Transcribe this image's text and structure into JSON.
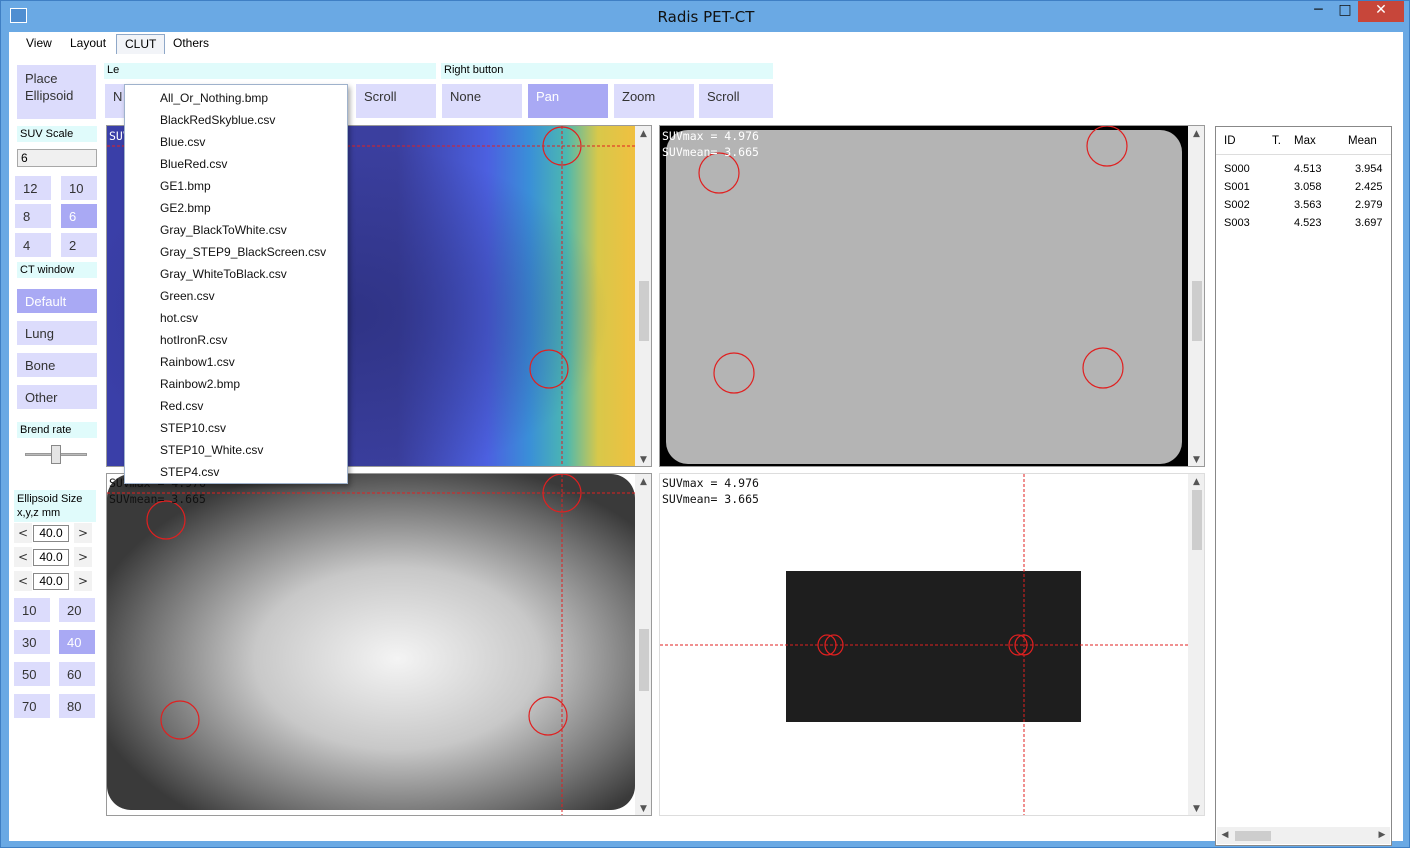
{
  "window": {
    "title": "Radis PET-CT",
    "minimize": "─",
    "maximize": "□",
    "close": "✕"
  },
  "menu": {
    "items": [
      "View",
      "Layout",
      "CLUT",
      "Others"
    ],
    "active": "CLUT"
  },
  "clut_menu": [
    "All_Or_Nothing.bmp",
    "BlackRedSkyblue.csv",
    "Blue.csv",
    "BlueRed.csv",
    "GE1.bmp",
    "GE2.bmp",
    "Gray_BlackToWhite.csv",
    "Gray_STEP9_BlackScreen.csv",
    "Gray_WhiteToBlack.csv",
    "Green.csv",
    "hot.csv",
    "hotIronR.csv",
    "Rainbow1.csv",
    "Rainbow2.bmp",
    "Red.csv",
    "STEP10.csv",
    "STEP10_White.csv",
    "STEP4.csv"
  ],
  "left_panel": {
    "place_ellipsoid": "Place Ellipsoid",
    "suv_scale_label": "SUV Scale",
    "suv_scale_value": "6",
    "suv_buttons": [
      "12",
      "10",
      "8",
      "6",
      "4",
      "2"
    ],
    "ct_window_label": "CT window",
    "ct_buttons": [
      "Default",
      "Lung",
      "Bone",
      "Other"
    ],
    "blend_label": "Brend rate",
    "ellipsoid_size_label": "Ellipsoid Size\nx,y,z mm",
    "ellipsoid_values": [
      "40.0",
      "40.0",
      "40.0"
    ],
    "size_buttons": [
      "10",
      "20",
      "30",
      "40",
      "50",
      "60",
      "70",
      "80"
    ]
  },
  "mouse_buttons": {
    "left_label": "Le",
    "left_first": "N",
    "left_scroll": "Scroll",
    "right_label": "Right button",
    "right": [
      "None",
      "Pan",
      "Zoom",
      "Scroll"
    ]
  },
  "suv_text": {
    "max": "SUVmax = 4.976",
    "mean": "SUVmean= 3.665"
  },
  "table": {
    "headers": [
      "ID",
      "T.",
      "Max",
      "Mean"
    ],
    "rows": [
      [
        "S000",
        "",
        "4.513",
        "3.954"
      ],
      [
        "S001",
        "",
        "3.058",
        "2.425"
      ],
      [
        "S002",
        "",
        "3.563",
        "2.979"
      ],
      [
        "S003",
        "",
        "4.523",
        "3.697"
      ]
    ]
  },
  "colors": {
    "button": "#dcdcfc",
    "button_selected": "#a9a9f4",
    "label_bg": "#e0fbfb",
    "roi": "#e02020",
    "title_bar": "#6aa9e4"
  }
}
